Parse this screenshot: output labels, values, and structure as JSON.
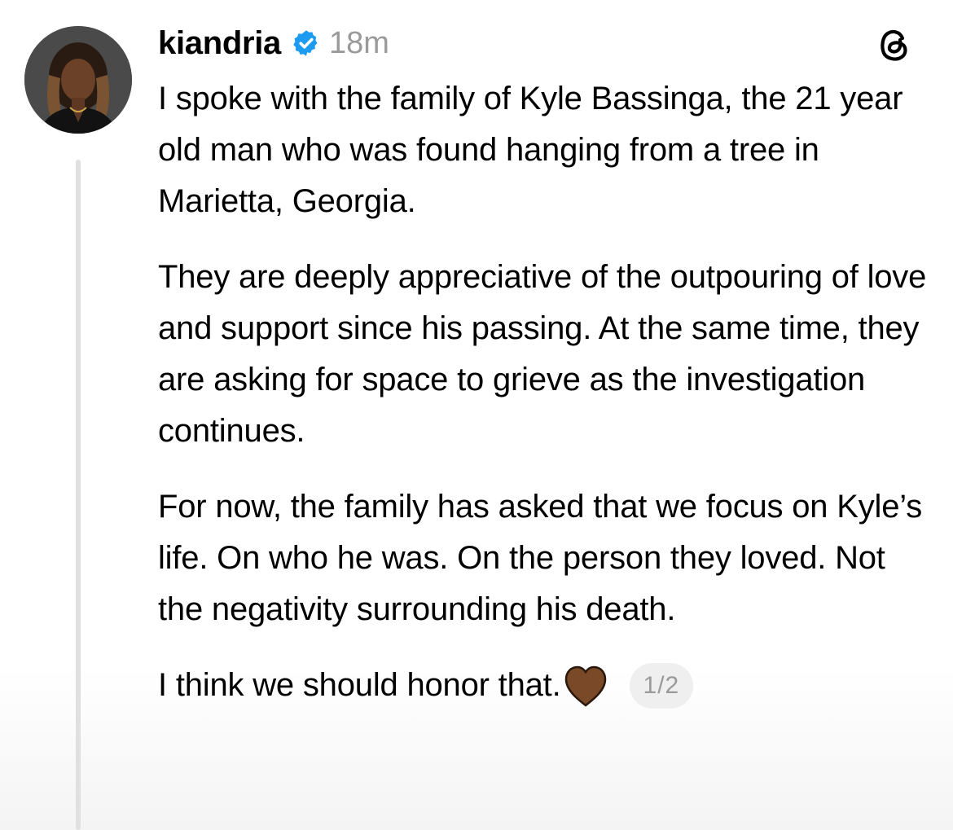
{
  "post": {
    "username": "kiandria",
    "verified": true,
    "timestamp": "18m",
    "paragraphs": [
      "I spoke with the family of Kyle Bassinga, the 21 year old man who was found hanging from a tree in Marietta, Georgia.",
      "They are deeply appreciative of the outpouring of love and support since his passing. At the same time, they are asking for space to grieve as the investigation continues.",
      "For now, the family has asked that we focus on Kyle’s life. On who he was. On the person they loved. Not the negativity surrounding his death."
    ],
    "closing_line": "I think we should honor that.",
    "closing_emoji": "brown-heart-icon",
    "thread_position": "1/2"
  },
  "icons": {
    "verified": "verified-badge-icon",
    "app": "threads-logo-icon"
  },
  "colors": {
    "verified_blue": "#1d9bf0",
    "heart_brown": "#7a4a28",
    "muted_text": "#9a9a9a",
    "badge_bg": "#efefef",
    "thread_line": "#e0e0e0"
  }
}
